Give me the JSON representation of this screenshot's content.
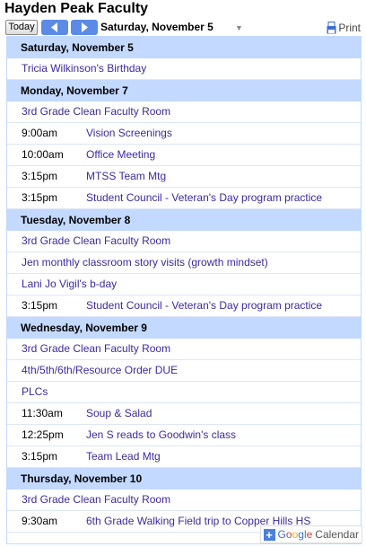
{
  "calendar": {
    "title": "Hayden Peak Faculty"
  },
  "toolbar": {
    "today_label": "Today",
    "date_range": "Saturday, November 5",
    "print_label": "Print"
  },
  "branding": {
    "google": [
      "G",
      "o",
      "o",
      "g",
      "l",
      "e"
    ],
    "calendar_word": "Calendar"
  },
  "days": [
    {
      "header": "Saturday, November 5",
      "events": [
        {
          "time": "",
          "title": "Tricia Wilkinson's Birthday"
        }
      ]
    },
    {
      "header": "Monday, November 7",
      "events": [
        {
          "time": "",
          "title": "3rd Grade Clean Faculty Room"
        },
        {
          "time": "9:00am",
          "title": "Vision Screenings"
        },
        {
          "time": "10:00am",
          "title": "Office Meeting"
        },
        {
          "time": "3:15pm",
          "title": "MTSS Team Mtg"
        },
        {
          "time": "3:15pm",
          "title": "Student Council - Veteran's Day program practice"
        }
      ]
    },
    {
      "header": "Tuesday, November 8",
      "events": [
        {
          "time": "",
          "title": "3rd Grade Clean Faculty Room"
        },
        {
          "time": "",
          "title": "Jen monthly classroom story visits (growth mindset)"
        },
        {
          "time": "",
          "title": "Lani Jo Vigil's b-day"
        },
        {
          "time": "3:15pm",
          "title": "Student Council - Veteran's Day program practice"
        }
      ]
    },
    {
      "header": "Wednesday, November 9",
      "events": [
        {
          "time": "",
          "title": "3rd Grade Clean Faculty Room"
        },
        {
          "time": "",
          "title": "4th/5th/6th/Resource Order DUE"
        },
        {
          "time": "",
          "title": "PLCs"
        },
        {
          "time": "11:30am",
          "title": "Soup & Salad"
        },
        {
          "time": "12:25pm",
          "title": "Jen S reads to Goodwin's class"
        },
        {
          "time": "3:15pm",
          "title": "Team Lead Mtg"
        }
      ]
    },
    {
      "header": "Thursday, November 10",
      "events": [
        {
          "time": "",
          "title": "3rd Grade Clean Faculty Room"
        },
        {
          "time": "9:30am",
          "title": "6th Grade Walking Field trip to Copper Hills HS"
        }
      ]
    }
  ]
}
